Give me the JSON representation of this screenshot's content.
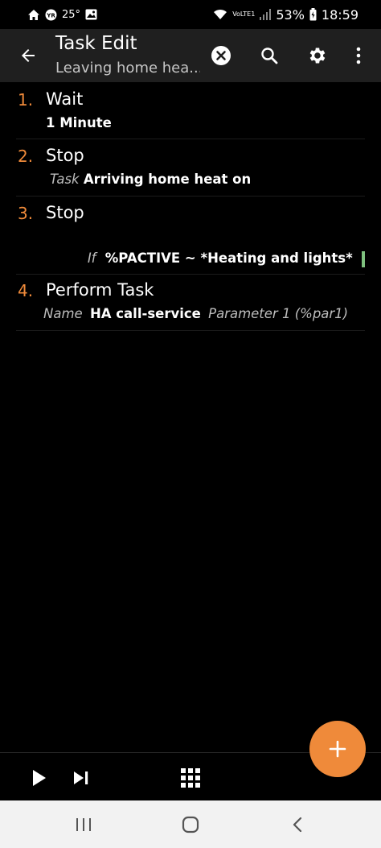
{
  "status_bar": {
    "temperature": "25°",
    "battery": "53%",
    "time": "18:59",
    "network": "VoLTE1"
  },
  "toolbar": {
    "title": "Task Edit",
    "subtitle": "Leaving home hea..."
  },
  "actions": [
    {
      "number": "1.",
      "name": "Wait",
      "args": [
        {
          "label": "",
          "value": "1 Minute",
          "extra": ""
        }
      ]
    },
    {
      "number": "2.",
      "name": "Stop",
      "args": [
        {
          "label": "Task",
          "value": "Arriving home heat on",
          "extra": ""
        }
      ]
    },
    {
      "number": "3.",
      "name": "Stop",
      "condition": {
        "label": "If",
        "value": "%PACTIVE ~ *Heating and lights*"
      }
    },
    {
      "number": "4.",
      "name": "Perform Task",
      "args": [
        {
          "label": "Name",
          "value": "HA call-service",
          "extra": "Parameter 1 (%par1)"
        }
      ]
    }
  ],
  "colors": {
    "accent": "#ef8a3a",
    "toolbar_bg": "#1f1f1f",
    "background": "#000000",
    "condition_bar": "#7ec07e"
  },
  "icons": {
    "back": "arrow-left-icon",
    "clear": "close-circle-icon",
    "search": "search-icon",
    "settings": "gear-icon",
    "more": "more-vert-icon",
    "add": "plus-icon",
    "play": "play-icon",
    "step": "skip-next-icon",
    "grid": "grid-icon"
  }
}
